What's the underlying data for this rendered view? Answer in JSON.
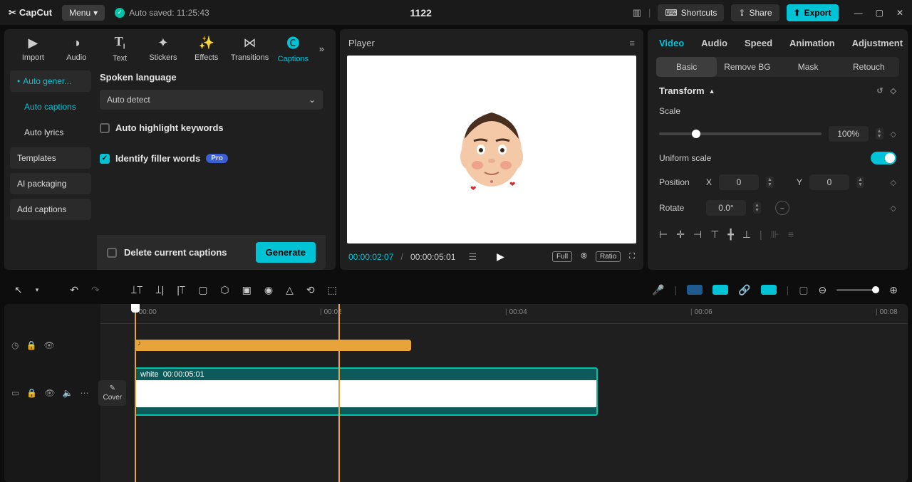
{
  "titlebar": {
    "logo": "CapCut",
    "menu": "Menu",
    "autosave": "Auto saved: 11:25:43",
    "project": "1122",
    "shortcuts": "Shortcuts",
    "share": "Share",
    "export": "Export"
  },
  "mediaTabs": {
    "import": "Import",
    "audio": "Audio",
    "text": "Text",
    "stickers": "Stickers",
    "effects": "Effects",
    "transitions": "Transitions",
    "captions": "Captions"
  },
  "sidebar": {
    "autogen": "Auto gener...",
    "autocaptions": "Auto captions",
    "autolyrics": "Auto lyrics",
    "templates": "Templates",
    "aipackaging": "AI packaging",
    "addcaptions": "Add captions"
  },
  "captions": {
    "spoken_label": "Spoken language",
    "detect": "Auto detect",
    "highlight": "Auto highlight keywords",
    "filler": "Identify filler words",
    "pro": "Pro",
    "delete": "Delete current captions",
    "generate": "Generate"
  },
  "player": {
    "title": "Player",
    "cur": "00:00:02:07",
    "dur": "00:00:05:01",
    "full": "Full",
    "ratio": "Ratio"
  },
  "inspector": {
    "tabs": {
      "video": "Video",
      "audio": "Audio",
      "speed": "Speed",
      "animation": "Animation",
      "adjust": "Adjustment"
    },
    "sub": {
      "basic": "Basic",
      "removebg": "Remove BG",
      "mask": "Mask",
      "retouch": "Retouch"
    },
    "transform": "Transform",
    "scale": "Scale",
    "scale_val": "100%",
    "uniform": "Uniform scale",
    "position": "Position",
    "px": "X",
    "py": "Y",
    "pxv": "0",
    "pyv": "0",
    "rotate": "Rotate",
    "rotv": "0.0°"
  },
  "timeline": {
    "marks": [
      "00:00",
      "00:02",
      "00:04",
      "00:06",
      "00:08"
    ],
    "clip_label": "white",
    "clip_dur": "00:00:05:01",
    "cover": "Cover"
  }
}
